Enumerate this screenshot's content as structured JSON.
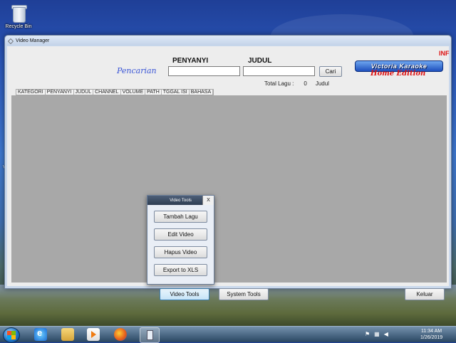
{
  "desktop": {
    "recycle_bin_label": "Recycle Bin",
    "side_text": "V"
  },
  "window": {
    "title": "Video Manager",
    "labels": {
      "penyanyi": "PENYANYI",
      "judul": "JUDUL",
      "pencarian": "Pencarian",
      "inf": "INF"
    },
    "search": {
      "penyanyi_value": "",
      "judul_value": "",
      "cari_button": "Cari"
    },
    "total": {
      "label": "Total Lagu :",
      "count": "0",
      "unit": "Judul"
    },
    "logo": {
      "main": "Victoria Karaoke",
      "sub": "Home Edition"
    },
    "table": {
      "columns": [
        "KATEGORI",
        "PENYANYI",
        "JUDUL",
        "CHANNEL",
        "VOLUME",
        "PATH",
        "TGGAL ISI",
        "BAHASA"
      ],
      "rows": []
    },
    "footer": {
      "video_tools": "Video Tools",
      "system_tools": "System Tools",
      "keluar": "Keluar"
    }
  },
  "popup": {
    "title": "Video Tools",
    "close": "X",
    "buttons": [
      "Tambah Lagu",
      "Edit Video",
      "Hapus Video",
      "Export to XLS"
    ]
  },
  "taskbar": {
    "time": "11:34 AM",
    "date": "1/26/2019"
  }
}
